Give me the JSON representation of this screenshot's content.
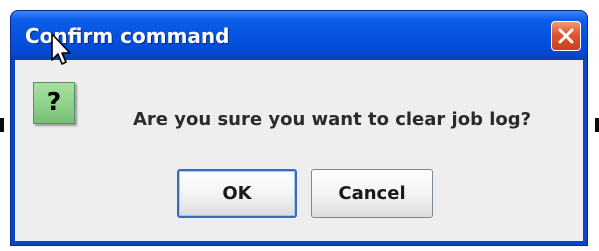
{
  "window": {
    "title": "Confirm command"
  },
  "dialog": {
    "icon_glyph": "?",
    "icon_name": "question-icon",
    "message": "Are you sure you want to clear job log?",
    "buttons": {
      "ok_label": "OK",
      "cancel_label": "Cancel"
    }
  },
  "colors": {
    "titlebar": "#0551df",
    "close_button": "#e0552f",
    "client_background": "#eeeeee",
    "icon_background": "#8fd08a",
    "default_button_border": "#3d6bb8"
  }
}
